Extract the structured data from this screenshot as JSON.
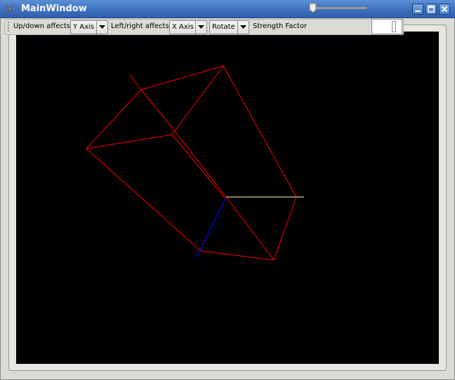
{
  "window": {
    "title": "MainWindow",
    "controls": [
      "minimize-icon",
      "maximize-icon",
      "close-icon"
    ]
  },
  "toolbar": {
    "updown_label": "Up/down affects",
    "updown_value": "Y Axis",
    "leftright_label": "Left/right affects",
    "leftright_value": "X Axis",
    "mode_value": "Rotate",
    "strength_label": "Strength Factor",
    "strength_slider_level": 0,
    "strength_value": ""
  },
  "colors": {
    "titlebar": "#3f72c0",
    "viewport_bg": "#000000",
    "wireframe": "#ff0000",
    "axis_x": "#ffffcc",
    "axis_z": "#0000ff"
  }
}
